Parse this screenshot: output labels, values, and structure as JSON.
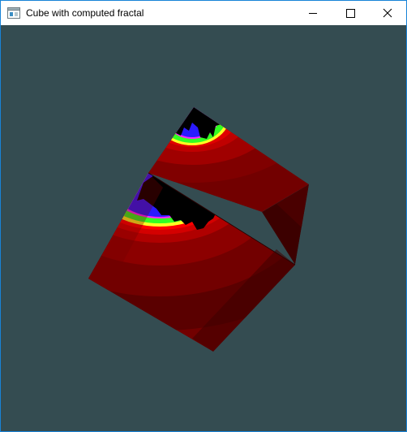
{
  "window": {
    "title": "Cube with computed fractal",
    "app_icon": "window-app-icon",
    "buttons": {
      "minimize_icon": "minimize-icon",
      "maximize_icon": "maximize-icon",
      "close_icon": "close-icon"
    }
  },
  "scene": {
    "background_color": "#344c51",
    "object": "rotating cube textured with a Mandelbrot fractal",
    "palette": {
      "fractal_interior": "#000000",
      "band_blue": "#2a1aff",
      "band_green": "#33ff22",
      "band_yellow": "#ffff22",
      "band_red_bright": "#d40000",
      "band_red": "#a00000",
      "band_red_dark": "#720000",
      "band_red_darkest": "#4a0000"
    }
  }
}
